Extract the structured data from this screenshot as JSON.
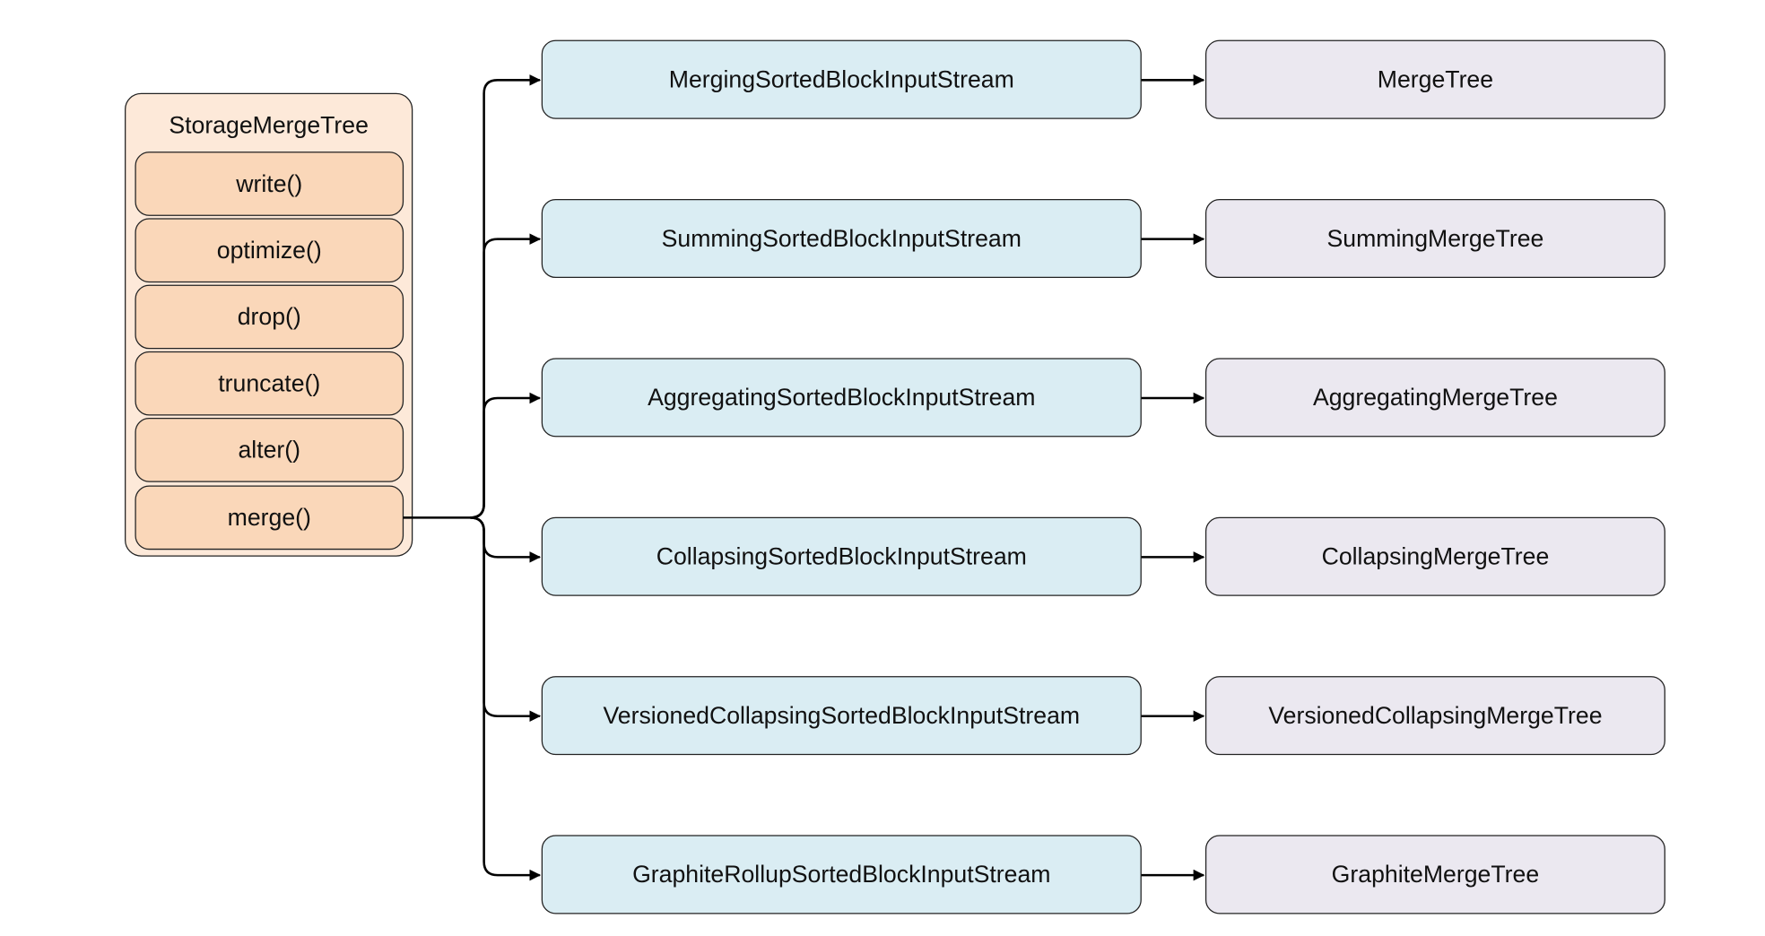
{
  "storage": {
    "title": "StorageMergeTree",
    "methods": [
      "write()",
      "optimize()",
      "drop()",
      "truncate()",
      "alter()",
      "merge()"
    ]
  },
  "streams": [
    {
      "stream": "MergingSortedBlockInputStream",
      "engine": "MergeTree"
    },
    {
      "stream": "SummingSortedBlockInputStream",
      "engine": "SummingMergeTree"
    },
    {
      "stream": "AggregatingSortedBlockInputStream",
      "engine": "AggregatingMergeTree"
    },
    {
      "stream": "CollapsingSortedBlockInputStream",
      "engine": "CollapsingMergeTree"
    },
    {
      "stream": "VersionedCollapsingSortedBlockInputStream",
      "engine": "VersionedCollapsingMergeTree"
    },
    {
      "stream": "GraphiteRollupSortedBlockInputStream",
      "engine": "GraphiteMergeTree"
    }
  ],
  "colors": {
    "container_fill": "#fde9d9",
    "method_fill": "#fad7b9",
    "stream_fill": "#daedf3",
    "engine_fill": "#ebe8f0",
    "stroke": "#222222"
  }
}
